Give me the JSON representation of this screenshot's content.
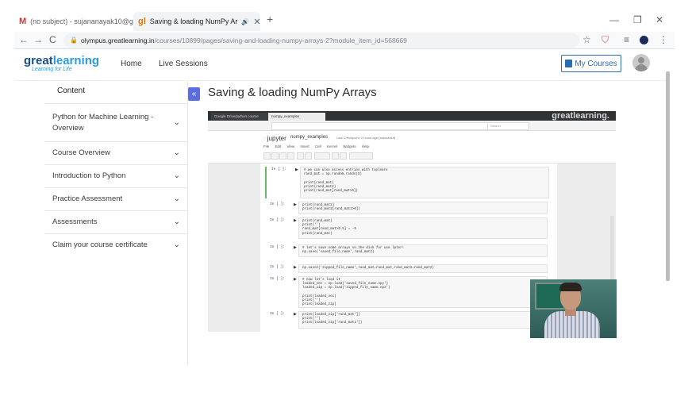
{
  "browser": {
    "tabs": [
      {
        "favicon": "M",
        "title": "(no subject) - sujananayak10@g",
        "close": "✕"
      },
      {
        "favicon": "gl",
        "title": "Saving & loading NumPy Ar",
        "audio": "🔊",
        "close": "✕"
      }
    ],
    "new_tab": "+",
    "window_controls": {
      "minimize": "—",
      "maximize": "❐",
      "close": "✕"
    },
    "url_host": "olympus.greatlearning.in",
    "url_path": "/courses/10899/pages/saving-and-loading-numpy-arrays-2?module_item_id=568669",
    "nav_icons": {
      "back": "←",
      "forward": "→",
      "reload": "C",
      "star": "☆",
      "shield": "⛉",
      "menu": "⋮",
      "queue": "≡"
    }
  },
  "site": {
    "logo": {
      "part1": "great",
      "part2": "learning",
      "tagline": "Learning for Life"
    },
    "nav": [
      {
        "label": "Home"
      },
      {
        "label": "Live Sessions"
      }
    ],
    "my_courses_label": "My Courses"
  },
  "sidebar": {
    "title": "Content",
    "items": [
      {
        "label": "Python for Machine Learning - Overview"
      },
      {
        "label": "Course Overview"
      },
      {
        "label": "Introduction to Python"
      },
      {
        "label": "Practice Assessment"
      },
      {
        "label": "Assessments"
      },
      {
        "label": "Claim your course certificate"
      }
    ],
    "chevron": "⌄"
  },
  "main": {
    "collapse_icon": "«",
    "page_title": "Saving & loading NumPy Arrays"
  },
  "video": {
    "watermark": "greatlearning.",
    "inner_tabs": [
      "Google Drive/python course",
      "numpy_examples"
    ],
    "search_placeholder": "Search",
    "jupyter_logo": "jupyter",
    "notebook_name": "numpy_examples",
    "checkpoint": "Last Checkpoint: 2 hours ago (autosaved)",
    "menu": "File Edit View Insert Cell Kernel Widgets Help",
    "cells": [
      {
        "prompt": "In [ ]:",
        "code": "# we can also access entries with topleare\nrand_mat = np.random.randn(5)\n\nprint(rand_mat)\nprint(rand_mat2)\nprint(rand_mat[rand_mat>0])"
      },
      {
        "prompt": "In [ ]:",
        "code": "print(rand_mat2)\nprint(rand_mat2[rand_mat2>0])"
      },
      {
        "prompt": "In [ ]:",
        "code": "print(rand_mat)\nprint('')\nrand_mat[rand_mat>0.5] = -5\nprint(rand_mat)"
      },
      {
        "prompt": "In [ ]:",
        "code": "# let's save some arrays on the disk for use later!\nnp.save('saved_file_name',rand_mat2)"
      },
      {
        "prompt": "In [ ]:",
        "code": "np.savez('zipped_file_name',rand_mat=rand_mat,rand_mat2=rand_mat2)"
      },
      {
        "prompt": "In [ ]:",
        "code": "# now let's load it\nloaded_vec = np.load('saved_file_name.npy')\nloaded_zip = np.load('zipped_file_name.npz')\n\nprint(loaded_vec)\nprint('')\nprint(loaded_zip)"
      },
      {
        "prompt": "In [ ]:",
        "code": "print(loaded_zip['rand_mat'])\nprint('')\nprint(loaded_zip['rand_mat2'])"
      }
    ]
  }
}
